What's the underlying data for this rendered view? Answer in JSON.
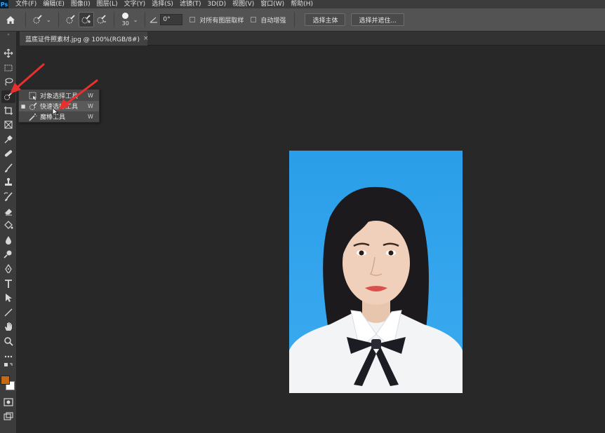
{
  "app": {
    "logo": "Ps"
  },
  "menubar": {
    "items": [
      "文件(F)",
      "编辑(E)",
      "图像(I)",
      "图层(L)",
      "文字(Y)",
      "选择(S)",
      "滤镜(T)",
      "3D(D)",
      "视图(V)",
      "窗口(W)",
      "帮助(H)"
    ]
  },
  "options": {
    "brush_size": "30",
    "angle_value": "0°",
    "sample_all_layers": "对所有图层取样",
    "auto_enhance": "自动增强",
    "select_subject": "选择主体",
    "select_and_mask": "选择并遮住..."
  },
  "document": {
    "tab_title": "蓝底证件照素材.jpg @ 100%(RGB/8#)",
    "close": "×"
  },
  "toolbar": {
    "collapse": "»",
    "tools": [
      "move-tool",
      "marquee-tool",
      "lasso-tool",
      "quick-selection-tool",
      "crop-tool",
      "frame-tool",
      "eyedropper-tool",
      "healing-tool",
      "brush-tool",
      "stamp-tool",
      "history-brush-tool",
      "eraser-tool",
      "paint-bucket-tool",
      "blur-tool",
      "dodge-tool",
      "pen-tool",
      "type-tool",
      "path-selection-tool",
      "line-tool",
      "hand-tool",
      "zoom-tool",
      "more-tools",
      "default-colors",
      "swatches",
      "quick-mask",
      "screen-mode"
    ],
    "foreground_color": "#c56a12",
    "background_color": "#ffffff"
  },
  "flyout": {
    "items": [
      {
        "label": "对象选择工具",
        "key": "W",
        "active": false,
        "icon": "object-selection-icon"
      },
      {
        "label": "快速选择工具",
        "key": "W",
        "active": true,
        "icon": "quick-selection-icon"
      },
      {
        "label": "魔棒工具",
        "key": "W",
        "active": false,
        "icon": "magic-wand-icon"
      }
    ]
  },
  "colors": {
    "photo_background": "#3aa7ef",
    "annotation_arrow": "#e8312f"
  }
}
